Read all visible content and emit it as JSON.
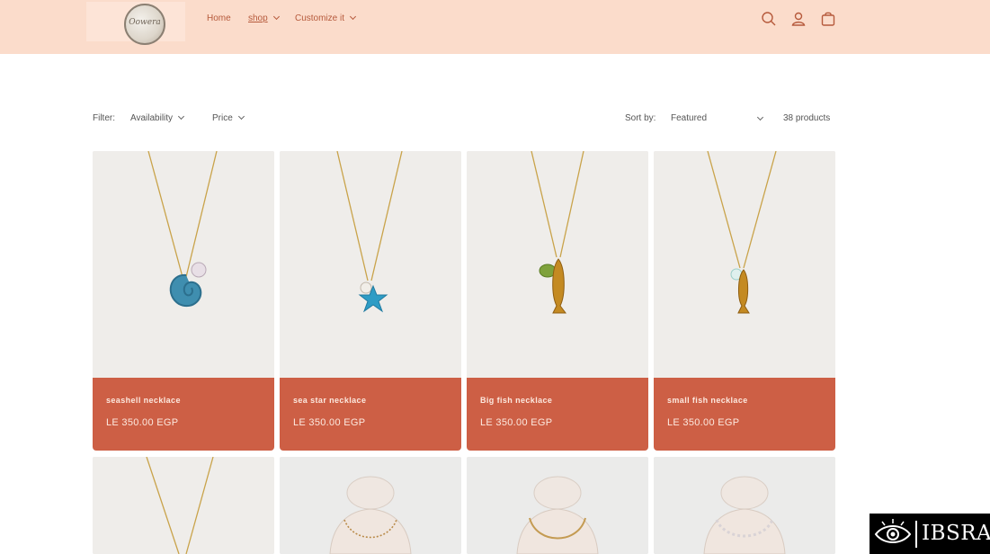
{
  "header": {
    "logo_text": "Oowera",
    "nav": {
      "home": "Home",
      "shop": "shop",
      "customize": "Customize it"
    }
  },
  "filters": {
    "filter_label": "Filter:",
    "availability": "Availability",
    "price": "Price",
    "sort_label": "Sort by:",
    "sort_value": "Featured",
    "count": "38 products"
  },
  "products": [
    {
      "title": "seashell necklace",
      "price": "LE 350.00 EGP"
    },
    {
      "title": "sea star necklace",
      "price": "LE 350.00 EGP"
    },
    {
      "title": "Big fish necklace",
      "price": "LE 350.00 EGP"
    },
    {
      "title": "small fish necklace",
      "price": "LE 350.00 EGP"
    }
  ],
  "watermark": {
    "text": "IBSRA"
  },
  "colors": {
    "header_bg": "#fbdccb",
    "card_info_bg": "#cd5f45",
    "nav_text": "#b65a3c"
  }
}
